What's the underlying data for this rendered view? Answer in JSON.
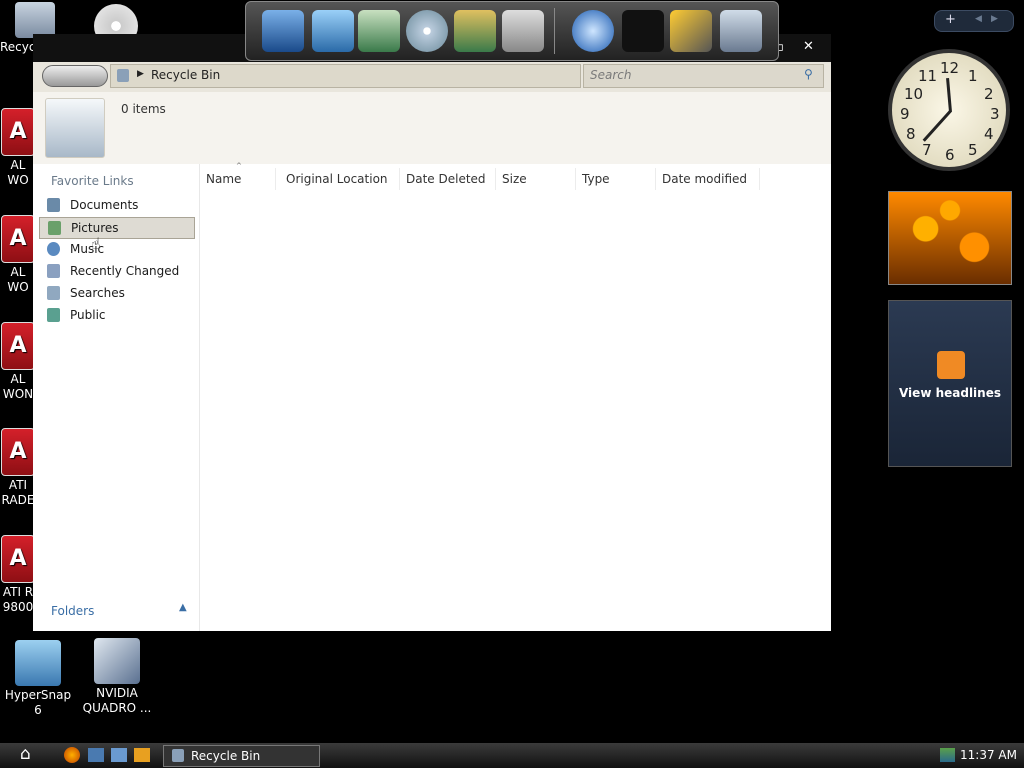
{
  "desktop": {
    "icons": [
      {
        "label": "Recyc",
        "top": 0
      },
      {
        "label": "AL\nWO",
        "top": 0
      },
      {
        "label": "AL\nWO",
        "top": 0
      },
      {
        "label": "AL\nWON",
        "top": 0
      },
      {
        "label": "ATI\nRADE",
        "top": 0
      },
      {
        "label": "ATI R\n9800",
        "top": 0
      }
    ],
    "hypersnap_label": "HyperSnap 6",
    "nvidia_label_1": "NVIDIA",
    "nvidia_label_2": "QUADRO ..."
  },
  "window": {
    "address_location": "Recycle Bin",
    "search_placeholder": "Search",
    "details_count": "0 items",
    "favorite_links_title": "Favorite Links",
    "nav_items": [
      {
        "label": "Documents",
        "icon": "documents-icon",
        "color": "#6a8aa8"
      },
      {
        "label": "Pictures",
        "icon": "pictures-icon",
        "color": "#6aa06a"
      },
      {
        "label": "Music",
        "icon": "music-icon",
        "color": "#5a8ac0"
      },
      {
        "label": "Recently Changed",
        "icon": "recently-changed-icon",
        "color": "#8aa0c0"
      },
      {
        "label": "Searches",
        "icon": "searches-icon",
        "color": "#90a8c0"
      },
      {
        "label": "Public",
        "icon": "public-icon",
        "color": "#5aa090"
      }
    ],
    "folders_label": "Folders",
    "columns": [
      "Name",
      "Original Location",
      "Date Deleted",
      "Size",
      "Type",
      "Date modified"
    ]
  },
  "taskbar": {
    "task_label": "Recycle Bin",
    "clock": "11:37 AM"
  },
  "gadgets": {
    "feed_label": "View headlines",
    "clock_numbers": [
      "12",
      "1",
      "2",
      "3",
      "4",
      "5",
      "6",
      "7",
      "8",
      "9",
      "10",
      "11"
    ]
  },
  "colors": {
    "accent": "#3a6ea5",
    "titlebar": "#111111",
    "selection": "#dedbd3"
  }
}
